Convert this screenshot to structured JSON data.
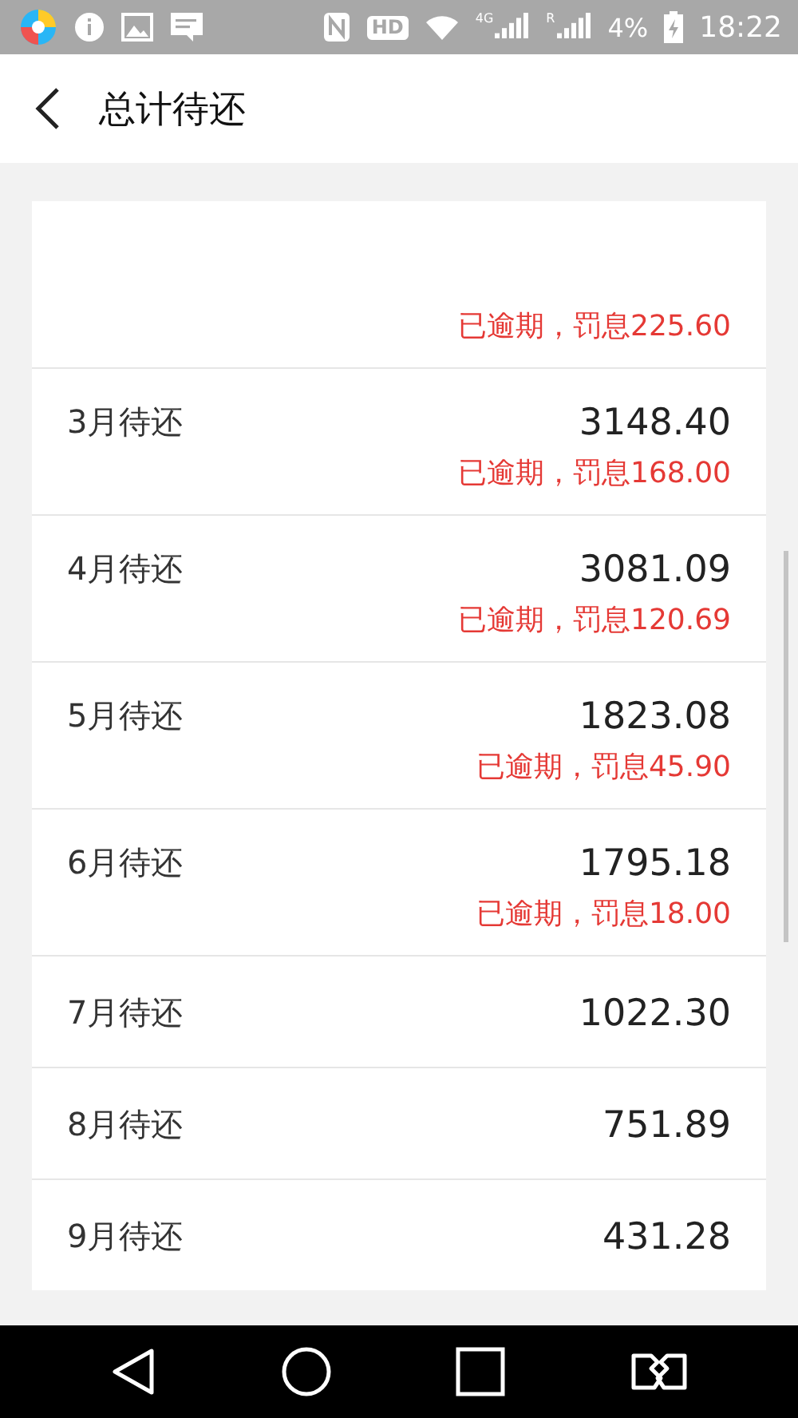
{
  "status_bar": {
    "hd": "HD",
    "network": "4G",
    "roaming": "R",
    "battery": "4%",
    "time": "18:22"
  },
  "header": {
    "title": "总计待还"
  },
  "rows": [
    {
      "overdue_note": "已逾期，罚息225.60"
    },
    {
      "label": "3月待还",
      "amount": "3148.40",
      "overdue_note": "已逾期，罚息168.00"
    },
    {
      "label": "4月待还",
      "amount": "3081.09",
      "overdue_note": "已逾期，罚息120.69"
    },
    {
      "label": "5月待还",
      "amount": "1823.08",
      "overdue_note": "已逾期，罚息45.90"
    },
    {
      "label": "6月待还",
      "amount": "1795.18",
      "overdue_note": "已逾期，罚息18.00"
    },
    {
      "label": "7月待还",
      "amount": "1022.30"
    },
    {
      "label": "8月待还",
      "amount": "751.89"
    },
    {
      "label": "9月待还",
      "amount": "431.28"
    }
  ]
}
